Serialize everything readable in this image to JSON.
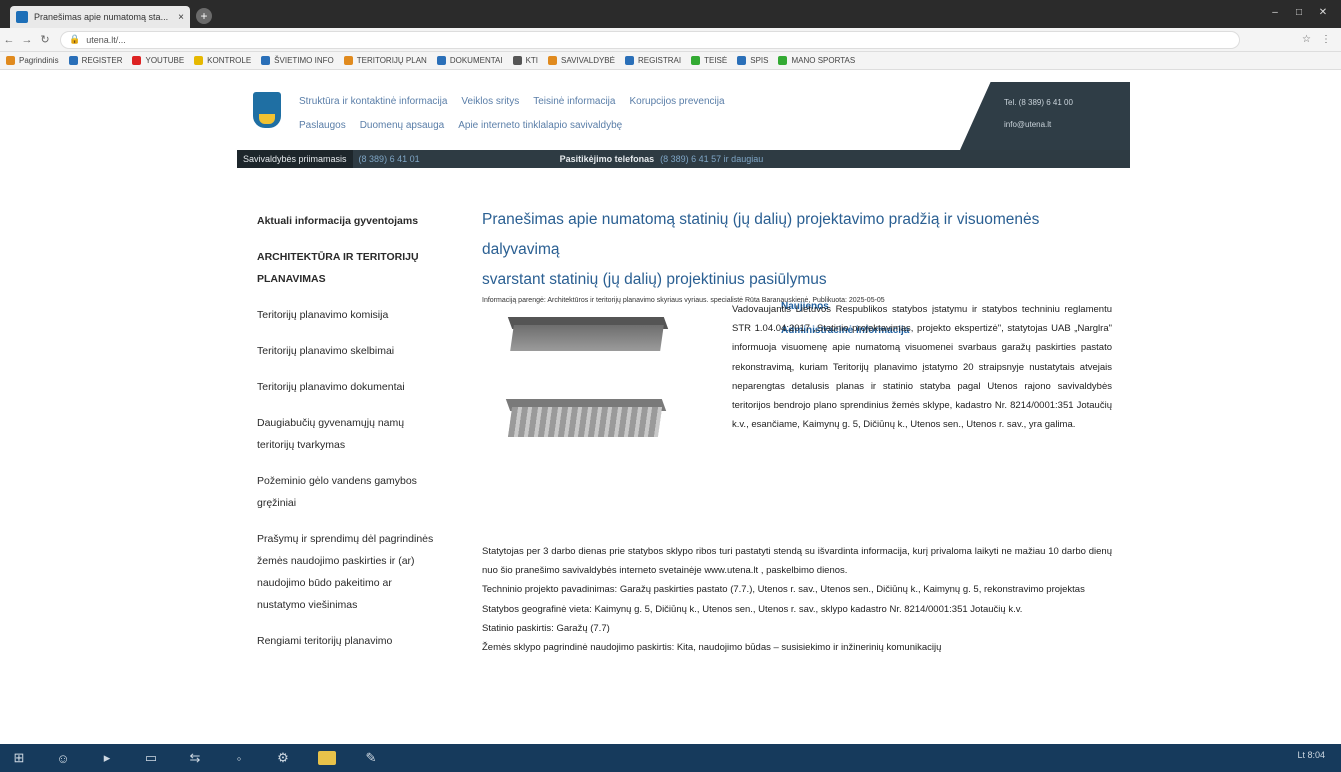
{
  "browser": {
    "tab_title": "Pranešimas apie numatomą sta...",
    "tab_close": "×",
    "new_tab": "+",
    "url": "utena.lt/..."
  },
  "bookmarks": [
    {
      "label": "Pagrindinis",
      "color": "#e08a1e"
    },
    {
      "label": "REGISTER",
      "color": "#2a6fb8"
    },
    {
      "label": "YOUTUBE",
      "color": "#d22"
    },
    {
      "label": "KONTROLE",
      "color": "#e6b800"
    },
    {
      "label": "ŠVIETIMO INFO",
      "color": "#2a6fb8"
    },
    {
      "label": "TERITORIJŲ PLAN",
      "color": "#e08a1e"
    },
    {
      "label": "DOKUMENTAI",
      "color": "#2a6fb8"
    },
    {
      "label": "KTI",
      "color": "#555"
    },
    {
      "label": "SAVIVALDYBĖ",
      "color": "#e08a1e"
    },
    {
      "label": "REGISTRAI",
      "color": "#2a6fb8"
    },
    {
      "label": "TEISĖ",
      "color": "#3a3"
    },
    {
      "label": "SPIS",
      "color": "#2a6fb8"
    },
    {
      "label": "MANO SPORTAS",
      "color": "#3a3"
    }
  ],
  "site": {
    "menu_row1": [
      {
        "label": "Naujienos",
        "style": "main"
      },
      {
        "label": "Struktūra ir kontaktinė informacija",
        "style": "sub"
      },
      {
        "label": "Veiklos sritys",
        "style": "sub"
      },
      {
        "label": "Teisinė informacija",
        "style": "sub"
      },
      {
        "label": "Korupcijos prevencija",
        "style": "sub"
      }
    ],
    "menu_row2": [
      {
        "label": "Administracinė informacija",
        "style": "main"
      },
      {
        "label": "Paslaugos",
        "style": "sub"
      },
      {
        "label": "Duomenų apsauga",
        "style": "sub"
      },
      {
        "label": "Apie interneto tinklalapio savivaldybę",
        "style": "sub"
      }
    ],
    "header_contact_1": "Tel. (8 389) 6 41 00",
    "header_contact_2": "info@utena.lt",
    "band_label_1": "Savivaldybės priimamasis",
    "band_value_1": "(8 389) 6 41 01",
    "band_label_2": "Pasitikėjimo telefonas",
    "band_value_2": "(8 389) 6 41 57 ir daugiau"
  },
  "sidebar": [
    {
      "label": "Aktuali informacija gyventojams",
      "style": "bold"
    },
    {
      "label": "ARCHITEKTŪRA IR TERITORIJŲ PLANAVIMAS",
      "style": "caps"
    },
    {
      "label": "Teritorijų planavimo komisija",
      "style": "normal"
    },
    {
      "label": "Teritorijų planavimo skelbimai",
      "style": "normal"
    },
    {
      "label": "Teritorijų planavimo dokumentai",
      "style": "normal"
    },
    {
      "label": "Daugiabučių gyvenamųjų namų teritorijų tvarkymas",
      "style": "normal"
    },
    {
      "label": "Požeminio gėlo vandens gamybos gręžiniai",
      "style": "normal"
    },
    {
      "label": "Prašymų ir sprendimų dėl pagrindinės žemės naudojimo paskirties ir (ar) naudojimo būdo pakeitimo ar nustatymo viešinimas",
      "style": "normal"
    },
    {
      "label": "Rengiami teritorijų planavimo",
      "style": "normal"
    }
  ],
  "article": {
    "title_line1": "Pranešimas apie numatomą statinių (jų dalių) projektavimo pradžią ir visuomenės dalyvavimą",
    "title_line2": "svarstant statinių (jų dalių) projektinius pasiūlymus",
    "meta": "Informaciją parengė: Architektūros ir teritorijų planavimo skyriaus vyriaus. specialistė Rūta Baranauskienė, Publikuota: 2025-05-05",
    "intro": "Vadovaujantis Lietuvos Respublikos statybos įstatymu ir statybos techniniu reglamentu STR 1.04.04:2017 „Statinio projektavimas, projekto ekspertizė\", statytojas UAB „Narglra\" informuoja visuomenę apie numatomą visuomenei svarbaus garažų paskirties pastato rekonstravimą, kuriam Teritorijų planavimo įstatymo 20 straipsnyje nustatytais atvejais neparengtas detalusis planas ir statinio statyba pagal Utenos rajono savivaldybės teritorijos bendrojo plano sprendinius žemės sklype, kadastro Nr. 8214/0001:351 Jotaučių k.v., esančiame, Kaimynų g. 5, Dičiūnų k., Utenos sen., Utenos r. sav., yra galima.",
    "paragraphs": [
      "Statytojas per 3 darbo dienas prie statybos sklypo ribos turi pastatyti stendą su išvardinta informacija, kurį privaloma laikyti ne mažiau 10 darbo dienų nuo šio pranešimo savivaldybės interneto svetainėje www.utena.lt , paskelbimo dienos.",
      "Techninio projekto pavadinimas: Garažų paskirties pastato (7.7.), Utenos r. sav., Utenos sen., Dičiūnų k., Kaimynų g. 5, rekonstravimo projektas",
      "Statybos geografinė vieta: Kaimynų g. 5, Dičiūnų k., Utenos sen., Utenos r. sav., sklypo kadastro Nr. 8214/0001:351 Jotaučių k.v.",
      "Statinio paskirtis: Garažų (7.7)",
      "Žemės sklypo pagrindinė naudojimo paskirtis: Kita, naudojimo būdas – susisiekimo ir inžinerinių komunikacijų"
    ]
  },
  "taskbar": {
    "tray_text": "Lt  8:04"
  }
}
